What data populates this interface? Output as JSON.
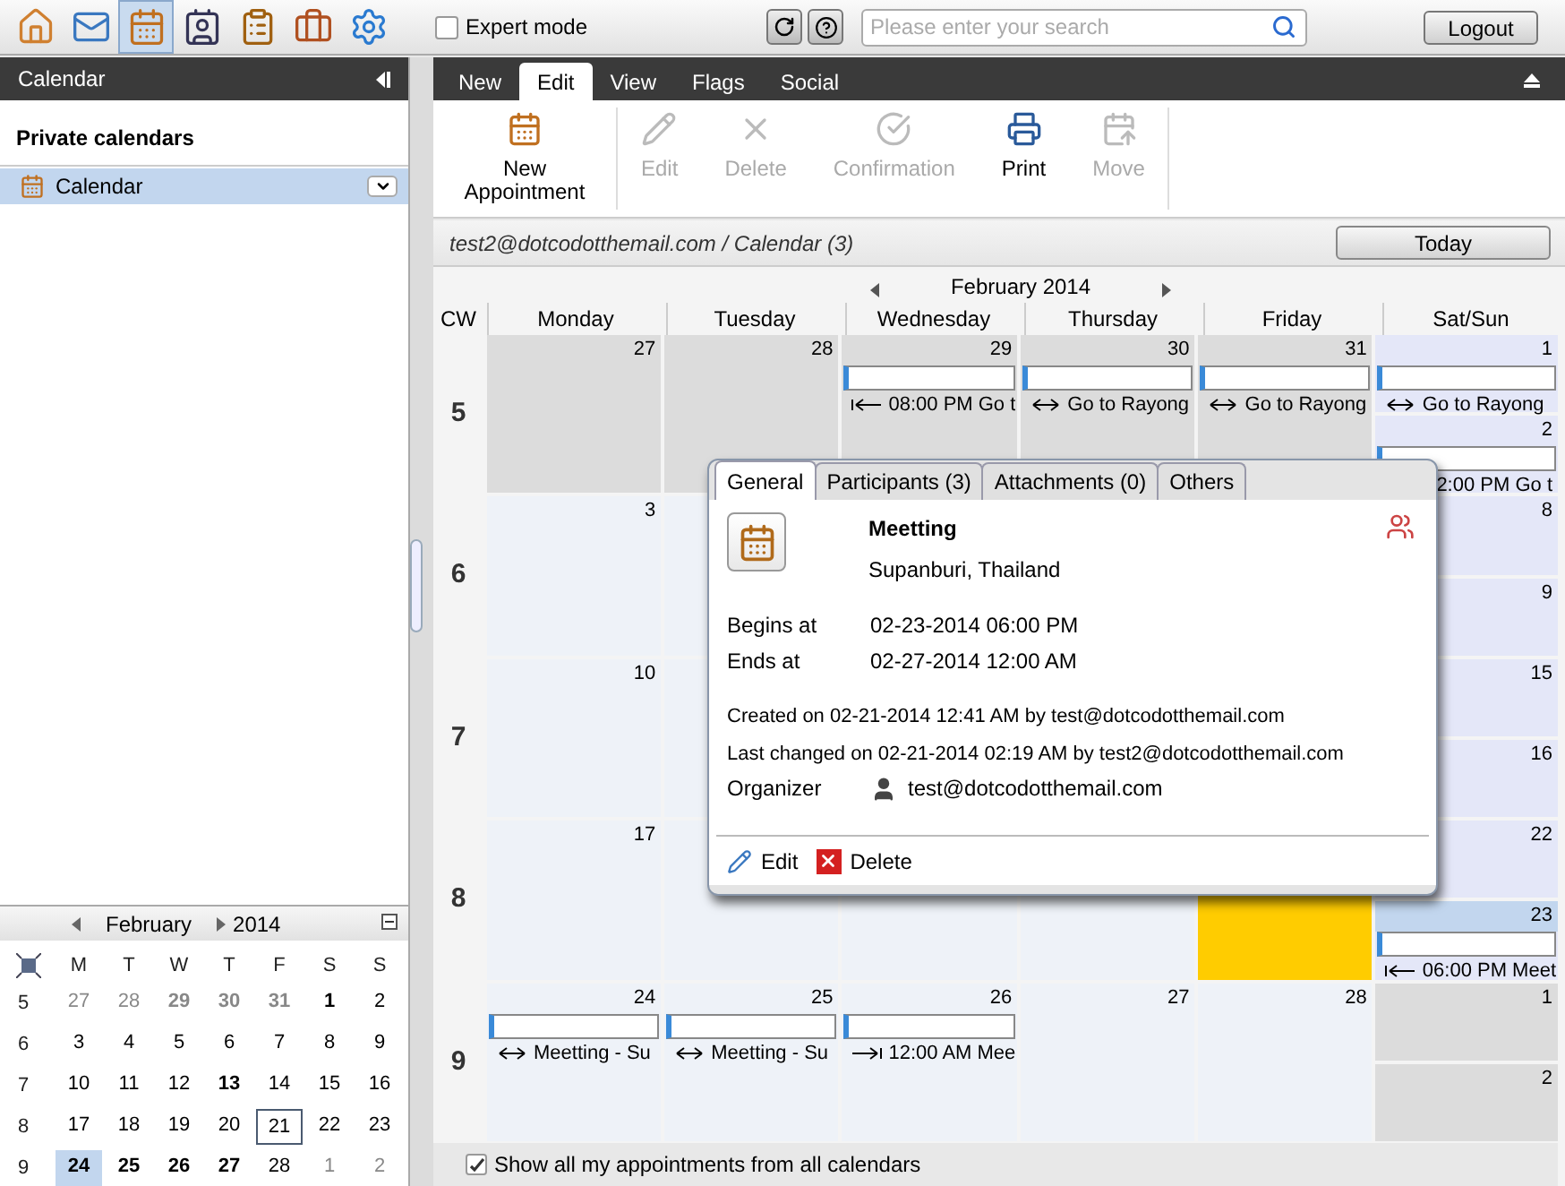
{
  "top_bar": {
    "apps": [
      {
        "kind": "home",
        "selected": false
      },
      {
        "kind": "mail",
        "selected": false
      },
      {
        "kind": "calendar",
        "selected": true
      },
      {
        "kind": "contacts",
        "selected": false
      },
      {
        "kind": "tasks",
        "selected": false
      },
      {
        "kind": "briefcase",
        "selected": false
      },
      {
        "kind": "settings",
        "selected": false
      }
    ],
    "expert_mode": {
      "label": "Expert mode",
      "checked": false
    },
    "search": {
      "placeholder": "Please enter your search"
    },
    "logout": "Logout"
  },
  "sidebar": {
    "title": "Calendar",
    "section": "Private calendars",
    "items": [
      {
        "label": "Calendar",
        "selected": true
      }
    ],
    "mini_calendar": {
      "month": "February",
      "year": "2014",
      "weekdays": [
        "M",
        "T",
        "W",
        "T",
        "F",
        "S",
        "S"
      ],
      "weeks": [
        {
          "cw": "5",
          "days": [
            {
              "d": "27",
              "kind": "muted",
              "selected": false
            },
            {
              "d": "28",
              "kind": "muted",
              "selected": false
            },
            {
              "d": "29",
              "kind": "muted-bold",
              "selected": false
            },
            {
              "d": "30",
              "kind": "muted-bold",
              "selected": false
            },
            {
              "d": "31",
              "kind": "muted-bold",
              "selected": false
            },
            {
              "d": "1",
              "kind": "bold",
              "selected": false
            },
            {
              "d": "2",
              "kind": "normal",
              "selected": false
            }
          ]
        },
        {
          "cw": "6",
          "days": [
            {
              "d": "3",
              "kind": "normal",
              "selected": false
            },
            {
              "d": "4",
              "kind": "normal",
              "selected": false
            },
            {
              "d": "5",
              "kind": "normal",
              "selected": false
            },
            {
              "d": "6",
              "kind": "normal",
              "selected": false
            },
            {
              "d": "7",
              "kind": "normal",
              "selected": false
            },
            {
              "d": "8",
              "kind": "normal",
              "selected": false
            },
            {
              "d": "9",
              "kind": "normal",
              "selected": false
            }
          ]
        },
        {
          "cw": "7",
          "days": [
            {
              "d": "10",
              "kind": "normal",
              "selected": false
            },
            {
              "d": "11",
              "kind": "normal",
              "selected": false
            },
            {
              "d": "12",
              "kind": "normal",
              "selected": false
            },
            {
              "d": "13",
              "kind": "bold",
              "selected": false
            },
            {
              "d": "14",
              "kind": "normal",
              "selected": false
            },
            {
              "d": "15",
              "kind": "normal",
              "selected": false
            },
            {
              "d": "16",
              "kind": "normal",
              "selected": false
            }
          ]
        },
        {
          "cw": "8",
          "days": [
            {
              "d": "17",
              "kind": "normal",
              "selected": false
            },
            {
              "d": "18",
              "kind": "normal",
              "selected": false
            },
            {
              "d": "19",
              "kind": "normal",
              "selected": false
            },
            {
              "d": "20",
              "kind": "normal",
              "selected": false
            },
            {
              "d": "21",
              "kind": "today",
              "selected": false
            },
            {
              "d": "22",
              "kind": "normal",
              "selected": false
            },
            {
              "d": "23",
              "kind": "normal",
              "selected": false
            }
          ]
        },
        {
          "cw": "9",
          "days": [
            {
              "d": "24",
              "kind": "bold",
              "selected": true
            },
            {
              "d": "25",
              "kind": "bold",
              "selected": false
            },
            {
              "d": "26",
              "kind": "bold",
              "selected": false
            },
            {
              "d": "27",
              "kind": "bold",
              "selected": false
            },
            {
              "d": "28",
              "kind": "normal",
              "selected": false
            },
            {
              "d": "1",
              "kind": "muted",
              "selected": false
            },
            {
              "d": "2",
              "kind": "muted",
              "selected": false
            }
          ]
        }
      ]
    }
  },
  "tabs": [
    {
      "label": "New",
      "selected": false
    },
    {
      "label": "Edit",
      "selected": true
    },
    {
      "label": "View",
      "selected": false
    },
    {
      "label": "Flags",
      "selected": false
    },
    {
      "label": "Social",
      "selected": false
    }
  ],
  "toolbar": [
    {
      "kind": "new",
      "label": "New Appointment",
      "disabled": false
    },
    {
      "kind": "edit",
      "label": "Edit",
      "disabled": true
    },
    {
      "kind": "delete",
      "label": "Delete",
      "disabled": true
    },
    {
      "kind": "confirm",
      "label": "Confirmation",
      "disabled": true
    },
    {
      "kind": "print",
      "label": "Print",
      "disabled": false
    },
    {
      "kind": "move",
      "label": "Move",
      "disabled": true
    }
  ],
  "breadcrumb": "test2@dotcodotthemail.com / Calendar (3)",
  "today_button": "Today",
  "calendar": {
    "month": "February 2014",
    "cw_label": "CW",
    "columns": [
      "Monday",
      "Tuesday",
      "Wednesday",
      "Thursday",
      "Friday",
      "Sat/Sun"
    ],
    "weeks": [
      {
        "cw": "5",
        "days": [
          {
            "number": "27",
            "kind": "other",
            "selected": false
          },
          {
            "number": "28",
            "kind": "other",
            "selected": false
          },
          {
            "number": "29",
            "kind": "other",
            "selected": false,
            "event": {
              "kind": "bar-left",
              "text": "08:00 PM Go t"
            }
          },
          {
            "number": "30",
            "kind": "other",
            "selected": false,
            "event": {
              "kind": "both",
              "text": "Go to Rayong"
            }
          },
          {
            "number": "31",
            "kind": "other",
            "selected": false,
            "event": {
              "kind": "both",
              "text": "Go to Rayong"
            }
          }
        ],
        "weekend": [
          {
            "number": "1",
            "kind": "weekend",
            "selected": false,
            "event": {
              "kind": "both",
              "text": "Go to Rayong"
            }
          },
          {
            "number": "2",
            "kind": "weekend",
            "selected": false,
            "event": {
              "kind": "none",
              "text": "2:00 PM Go t"
            }
          }
        ]
      },
      {
        "cw": "6",
        "days": [
          {
            "number": "3",
            "kind": "current",
            "selected": false
          },
          {
            "kind": "current",
            "selected": false
          }
        ],
        "weekend": [
          {
            "number": "8",
            "kind": "weekend",
            "selected": false
          },
          {
            "number": "9",
            "kind": "weekend",
            "selected": false
          }
        ]
      },
      {
        "cw": "7",
        "days": [
          {
            "number": "10",
            "kind": "current",
            "selected": false
          },
          {
            "kind": "current",
            "selected": false
          }
        ],
        "weekend": [
          {
            "number": "15",
            "kind": "weekend",
            "selected": false
          },
          {
            "number": "16",
            "kind": "weekend",
            "selected": false
          }
        ]
      },
      {
        "cw": "8",
        "days": [
          {
            "number": "17",
            "kind": "current",
            "selected": false
          },
          {
            "kind": "current",
            "selected": false
          },
          {
            "kind": "current"
          },
          {
            "kind": "current"
          },
          {
            "kind": "today"
          }
        ],
        "weekend": [
          {
            "number": "22",
            "kind": "weekend",
            "selected": false
          },
          {
            "number": "23",
            "kind": "weekend",
            "selected": true,
            "event": {
              "kind": "bar-left",
              "text": "06:00 PM Meet"
            }
          }
        ]
      },
      {
        "cw": "9",
        "days": [
          {
            "number": "24",
            "kind": "current",
            "selected": false,
            "event": {
              "kind": "both",
              "text": "Meetting - Su"
            }
          },
          {
            "number": "25",
            "kind": "current",
            "selected": false,
            "event": {
              "kind": "both",
              "text": "Meetting - Su"
            }
          },
          {
            "number": "26",
            "kind": "current",
            "selected": false,
            "event": {
              "kind": "bar-right",
              "text": "12:00 AM Mee"
            }
          },
          {
            "number": "27",
            "kind": "current",
            "selected": false
          },
          {
            "number": "28",
            "kind": "current",
            "selected": false
          }
        ],
        "weekend": [
          {
            "number": "1",
            "kind": "other",
            "selected": false
          },
          {
            "number": "2",
            "kind": "other",
            "selected": false
          }
        ]
      }
    ]
  },
  "popup": {
    "tabs": [
      {
        "label": "General",
        "selected": true
      },
      {
        "label": "Participants (3)",
        "selected": false
      },
      {
        "label": "Attachments (0)",
        "selected": false
      },
      {
        "label": "Others",
        "selected": false
      }
    ],
    "title": "Meetting",
    "location": "Supanburi, Thailand",
    "begins_label": "Begins at",
    "begins": "02-23-2014 06:00 PM",
    "ends_label": "Ends at",
    "ends": "02-27-2014 12:00 AM",
    "created": "Created on 02-21-2014 12:41 AM by test@dotcodotthemail.com",
    "changed": "Last changed on 02-21-2014 02:19 AM by test2@dotcodotthemail.com",
    "organizer_label": "Organizer",
    "organizer": "test@dotcodotthemail.com",
    "actions": [
      {
        "kind": "edit",
        "label": "Edit"
      },
      {
        "kind": "delete",
        "label": "Delete"
      }
    ]
  },
  "footer": {
    "label": "Show all my appointments from all calendars",
    "checked": true
  }
}
